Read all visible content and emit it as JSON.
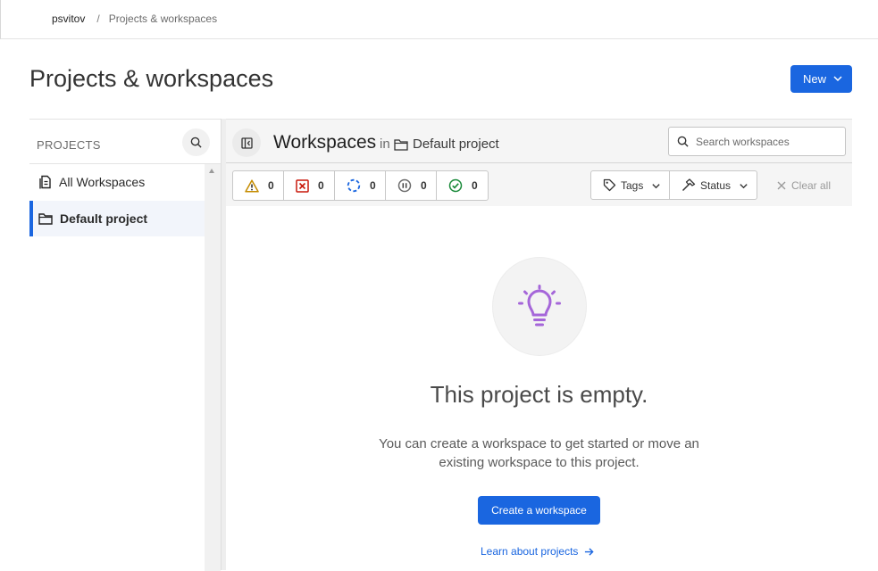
{
  "breadcrumb": {
    "org": "psvitov",
    "separator": "/",
    "page": "Projects & workspaces"
  },
  "page": {
    "title": "Projects & workspaces",
    "new_button": "New"
  },
  "projects_panel": {
    "title": "PROJECTS",
    "items": [
      {
        "label": "All Workspaces",
        "icon": "files-icon",
        "active": false
      },
      {
        "label": "Default project",
        "icon": "folder-icon",
        "active": true
      }
    ]
  },
  "workspaces": {
    "title": "Workspaces",
    "in_label": "in",
    "project_name": "Default project",
    "search_placeholder": "Search workspaces",
    "status_counts": [
      {
        "name": "warning",
        "icon": "warning-icon",
        "count": "0",
        "color": "#c58c00"
      },
      {
        "name": "errored",
        "icon": "error-icon",
        "count": "0",
        "color": "#c9190b"
      },
      {
        "name": "running",
        "icon": "running-icon",
        "count": "0",
        "color": "#1a66e0"
      },
      {
        "name": "paused",
        "icon": "pause-icon",
        "count": "0",
        "color": "#6b6b6b"
      },
      {
        "name": "success",
        "icon": "check-icon",
        "count": "0",
        "color": "#1a8a3a"
      }
    ],
    "tags_label": "Tags",
    "status_label": "Status",
    "clear_all": "Clear all"
  },
  "empty_state": {
    "title": "This project is empty.",
    "description": "You can create a workspace to get started or move an existing workspace to this project.",
    "create_button": "Create a workspace",
    "learn_link": "Learn about projects",
    "bulb_color": "#a566d9"
  },
  "colors": {
    "accent": "#1a66e0"
  }
}
